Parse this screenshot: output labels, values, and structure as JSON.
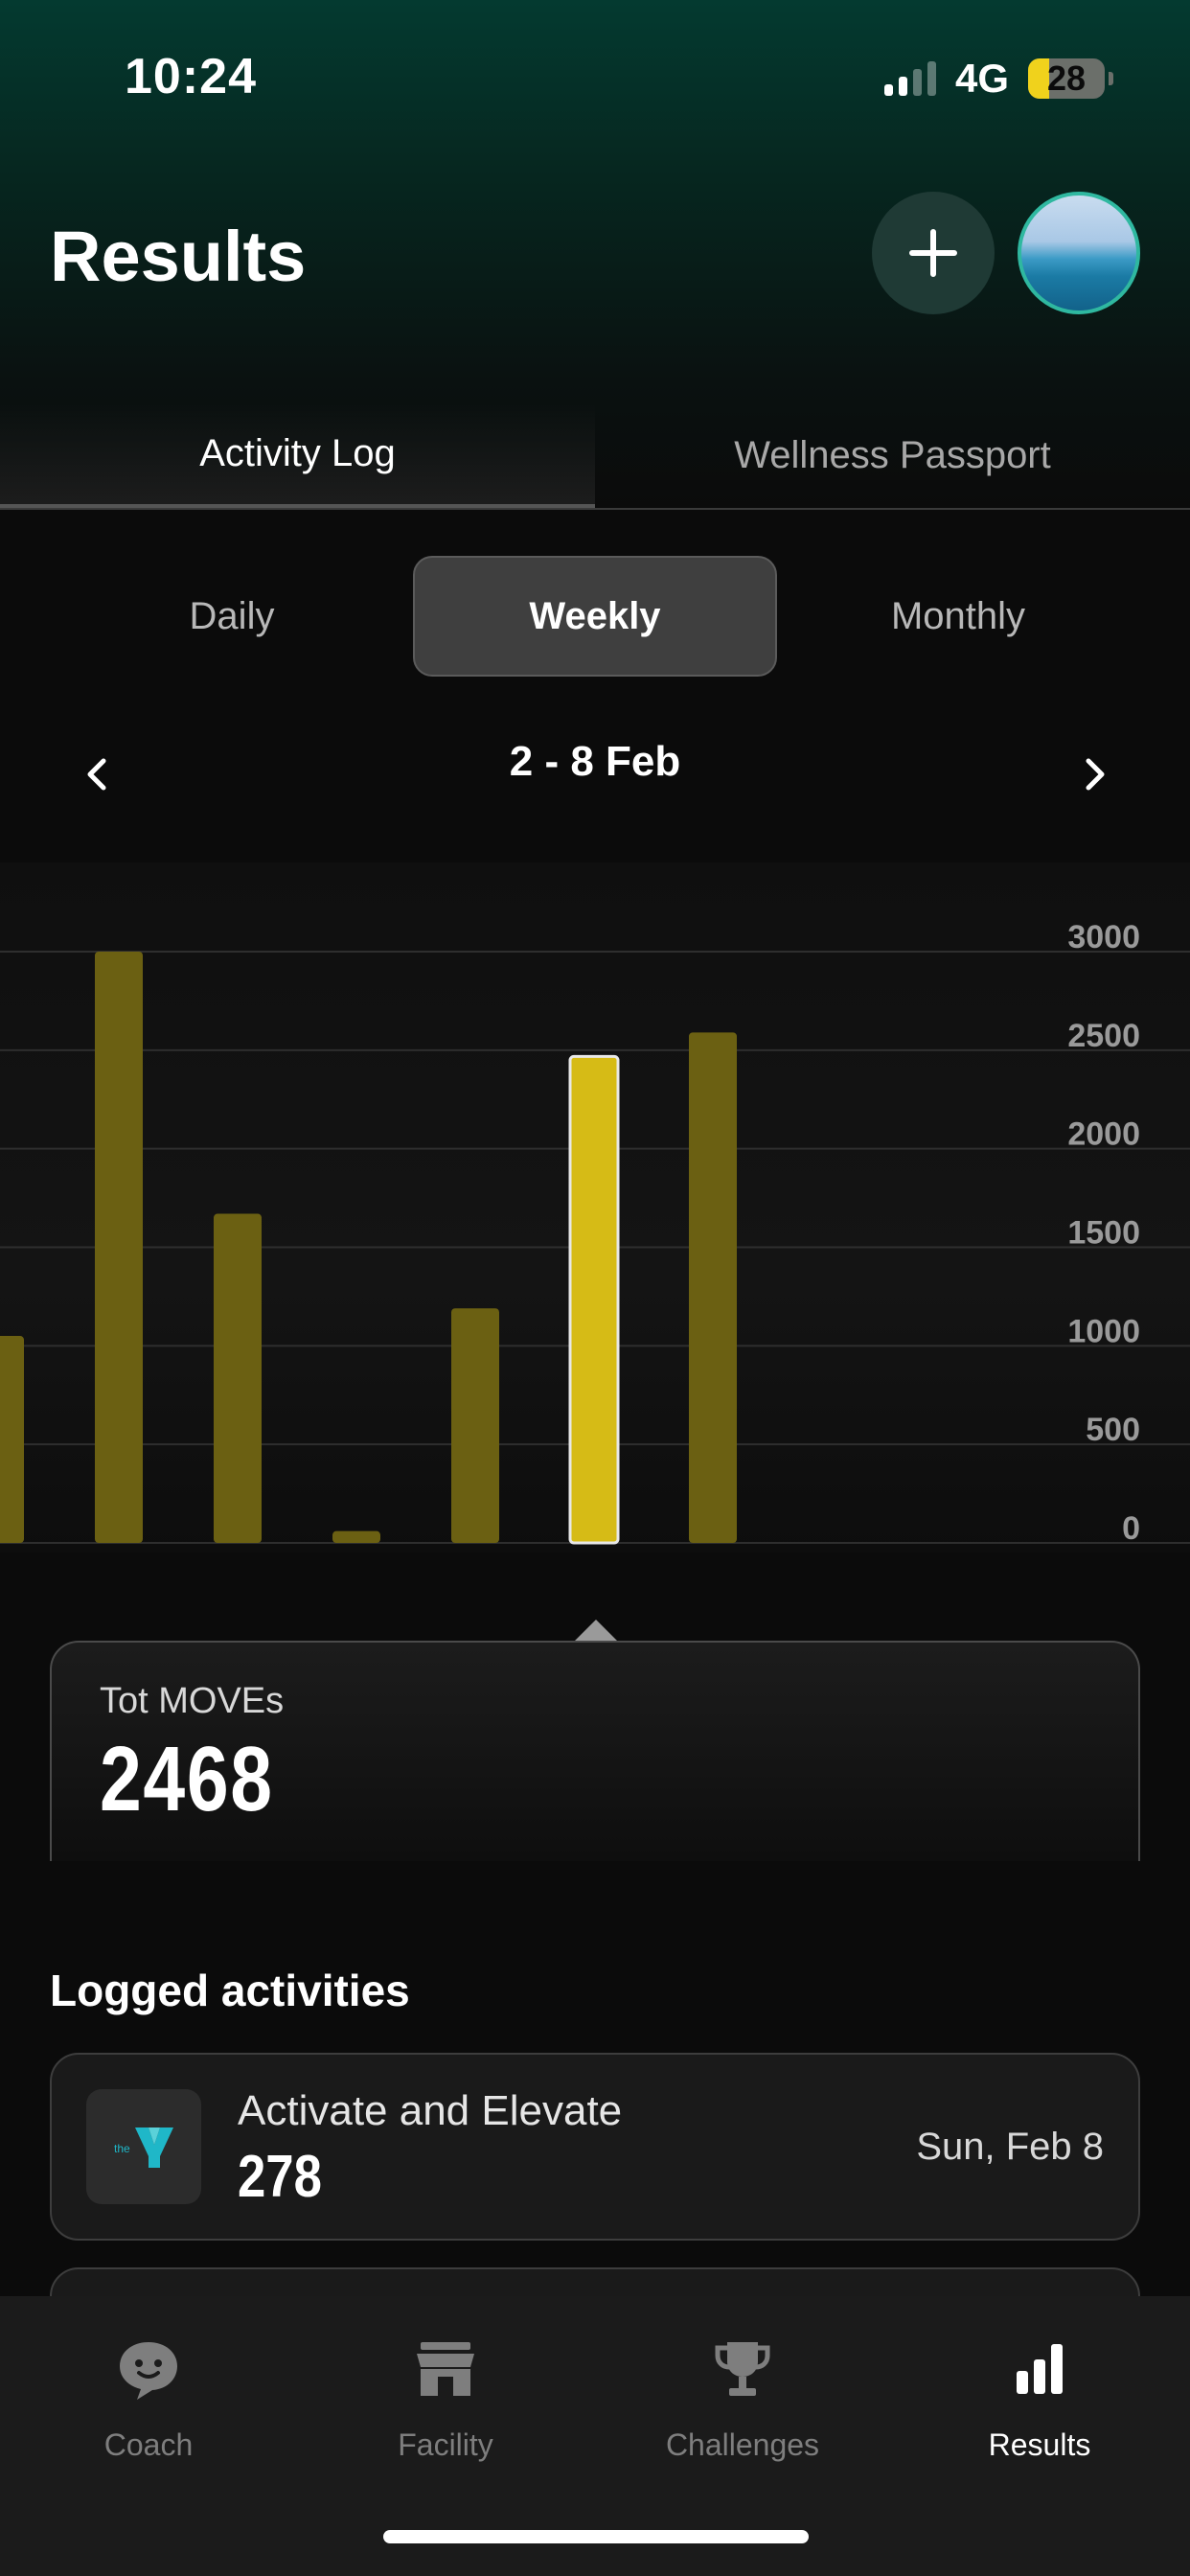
{
  "status_bar": {
    "time": "10:24",
    "network": "4G",
    "battery": "28"
  },
  "header": {
    "title": "Results"
  },
  "tabs": [
    {
      "label": "Activity Log",
      "active": true
    },
    {
      "label": "Wellness Passport",
      "active": false
    }
  ],
  "period": {
    "options": [
      "Daily",
      "Weekly",
      "Monthly"
    ],
    "selected": "Weekly"
  },
  "range": {
    "label": "2 - 8 Feb"
  },
  "chart_data": {
    "type": "bar",
    "y_ticks": [
      "3000",
      "2500",
      "2000",
      "1500",
      "1000",
      "500",
      "0"
    ],
    "ylim": [
      0,
      3000
    ],
    "grid": true,
    "values": [
      1050,
      3000,
      1670,
      60,
      1190,
      2468,
      2590
    ],
    "selected_index": 5,
    "colors": {
      "bar": "#6b6012",
      "selected": "#d6bb16"
    }
  },
  "total": {
    "label": "Tot MOVEs",
    "value": "2468"
  },
  "logged": {
    "title": "Logged activities",
    "items": [
      {
        "name": "Activate and Elevate",
        "moves": "278",
        "date": "Sun, Feb 8",
        "logo": "the-y-logo"
      }
    ]
  },
  "nav": [
    {
      "label": "Coach",
      "icon": "chat-bubble-icon",
      "active": false
    },
    {
      "label": "Facility",
      "icon": "storefront-icon",
      "active": false
    },
    {
      "label": "Challenges",
      "icon": "trophy-icon",
      "active": false
    },
    {
      "label": "Results",
      "icon": "bar-chart-icon",
      "active": true
    }
  ]
}
